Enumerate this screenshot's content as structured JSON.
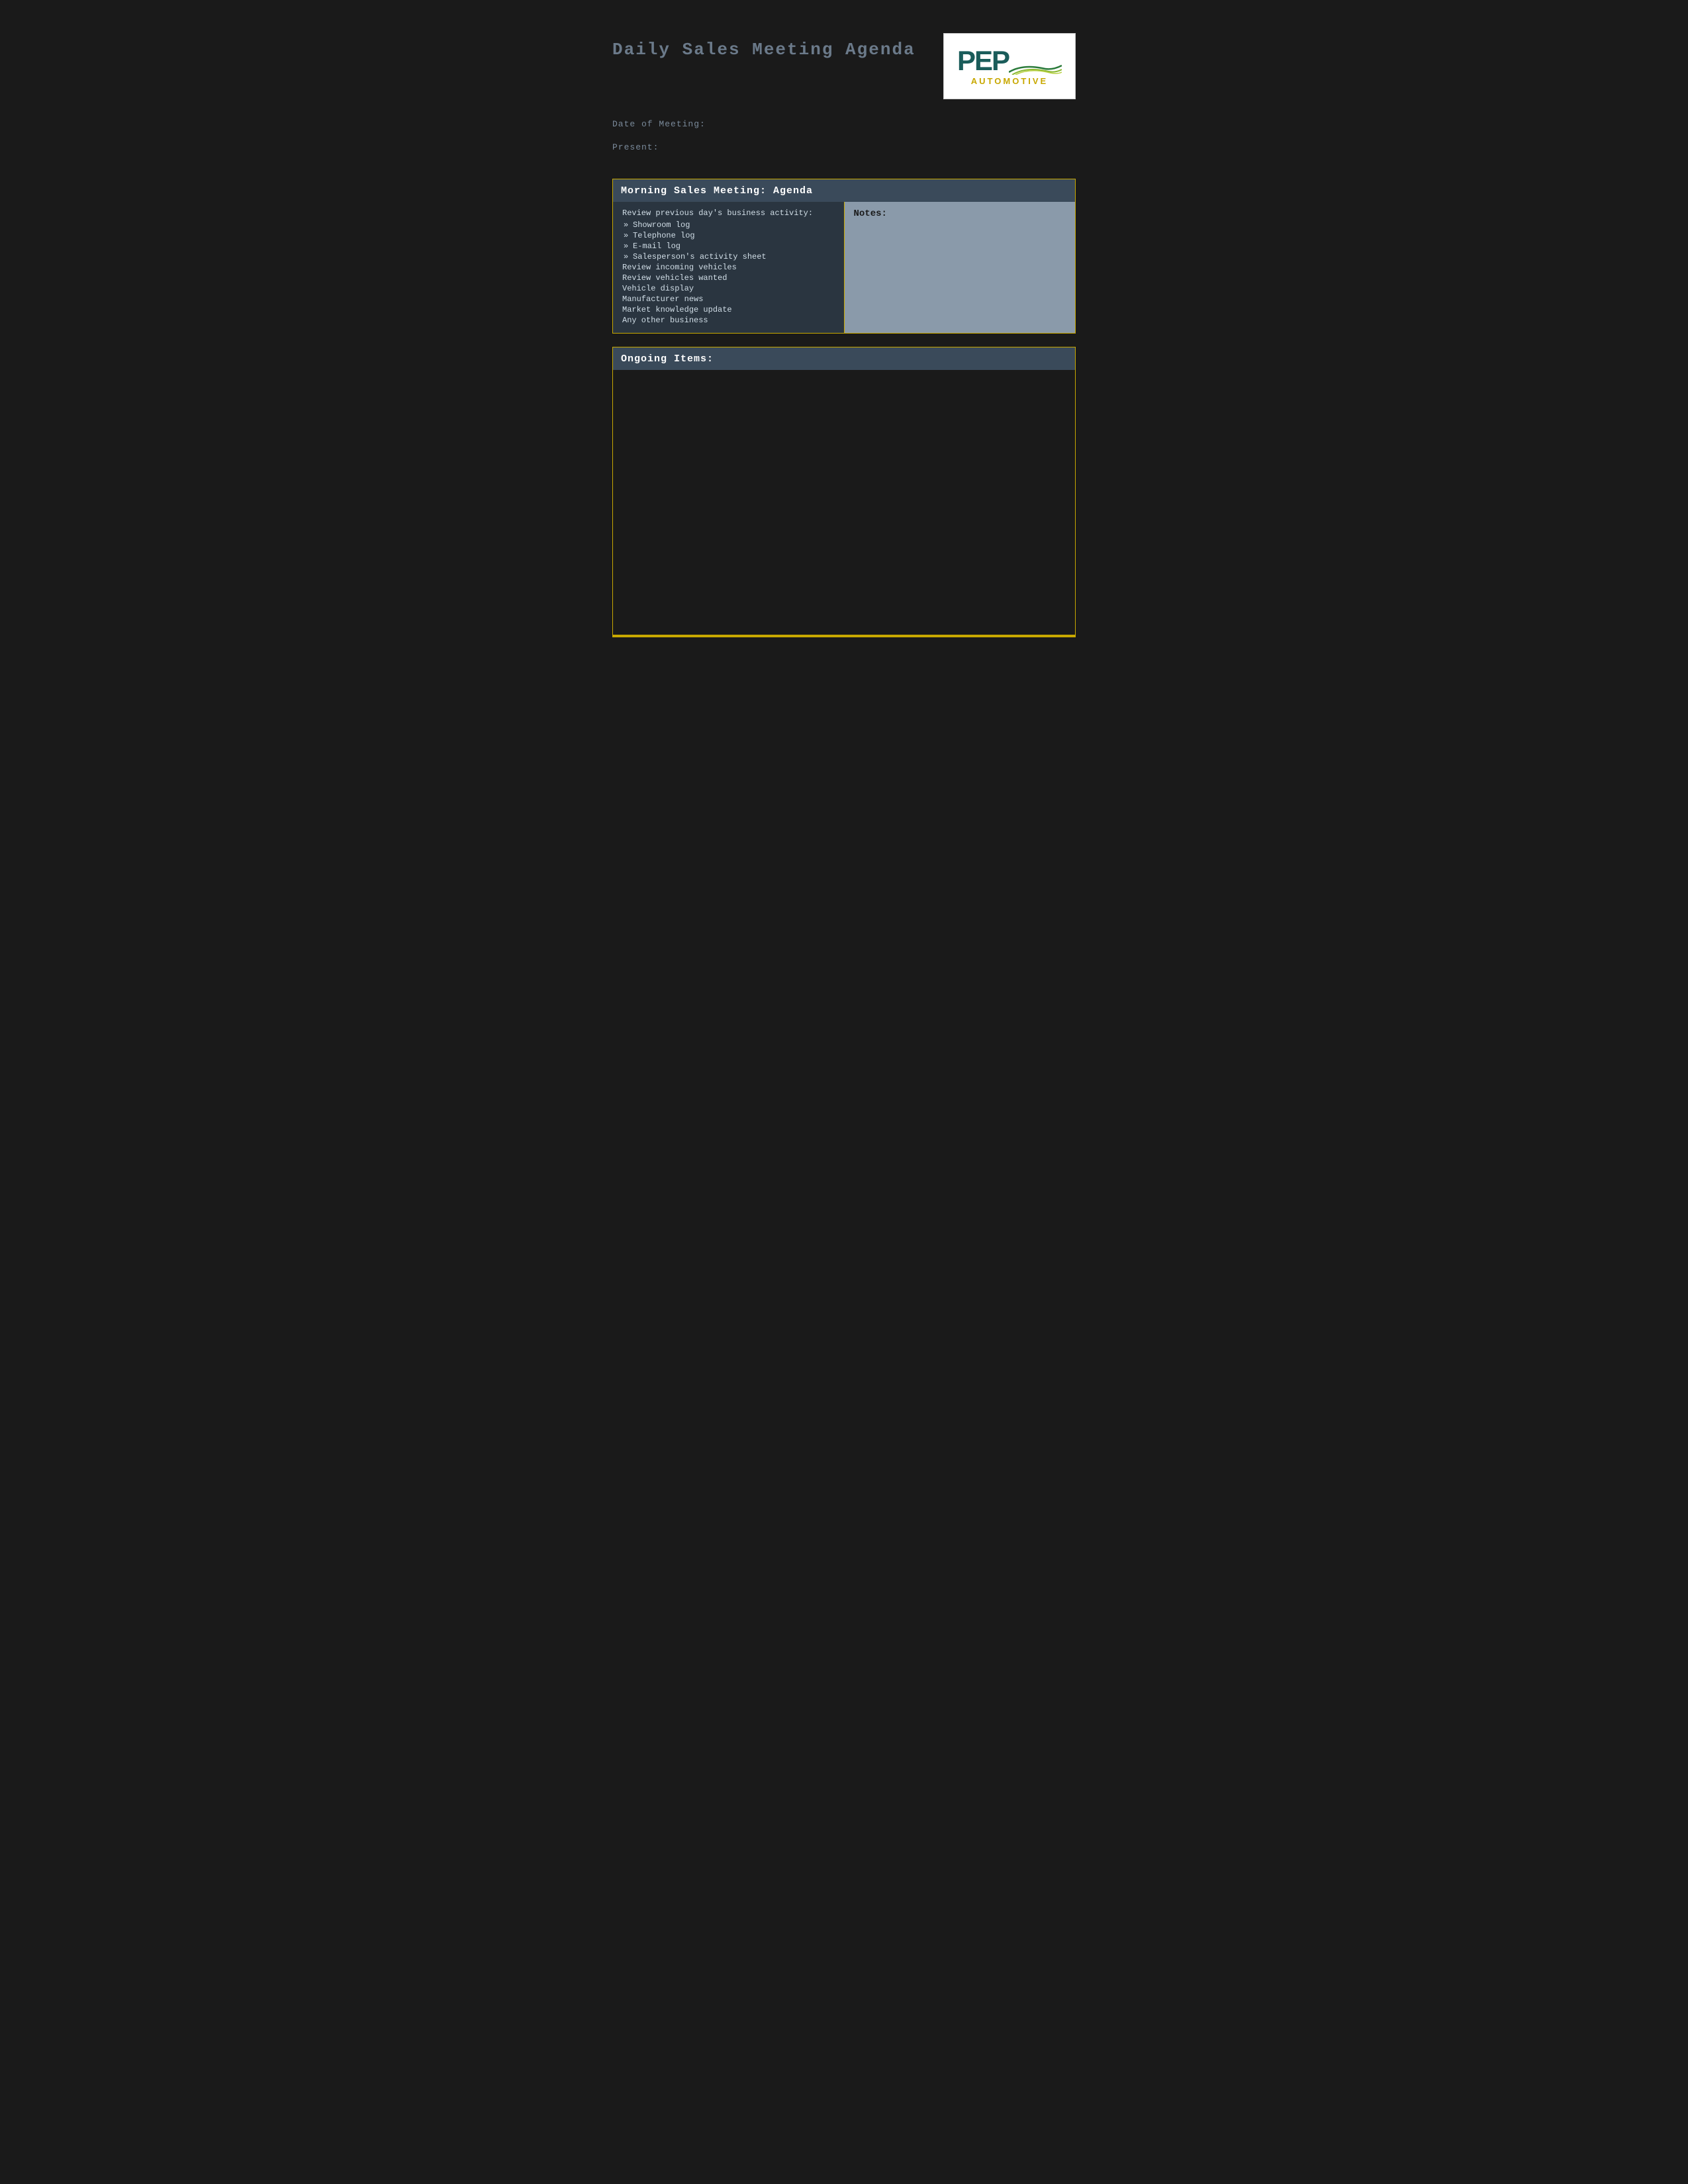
{
  "page": {
    "title": "Daily Sales Meeting Agenda",
    "logo": {
      "brand": "PEP",
      "tagline": "AUTOMOTIVE"
    },
    "meta": {
      "date_label": "Date of Meeting:",
      "present_label": "Present:"
    },
    "morning_section": {
      "header": "Morning Sales Meeting: Agenda",
      "agenda_intro": "Review previous day's business activity:",
      "agenda_subitems": [
        "Showroom log",
        "Telephone log",
        "E-mail log",
        "Salesperson's activity sheet"
      ],
      "agenda_plain_items": [
        "Review incoming vehicles",
        "Review vehicles wanted",
        "Vehicle display",
        "Manufacturer news",
        "Market knowledge update",
        "Any other business"
      ],
      "notes_label": "Notes:"
    },
    "ongoing_section": {
      "header": "Ongoing Items:"
    }
  }
}
